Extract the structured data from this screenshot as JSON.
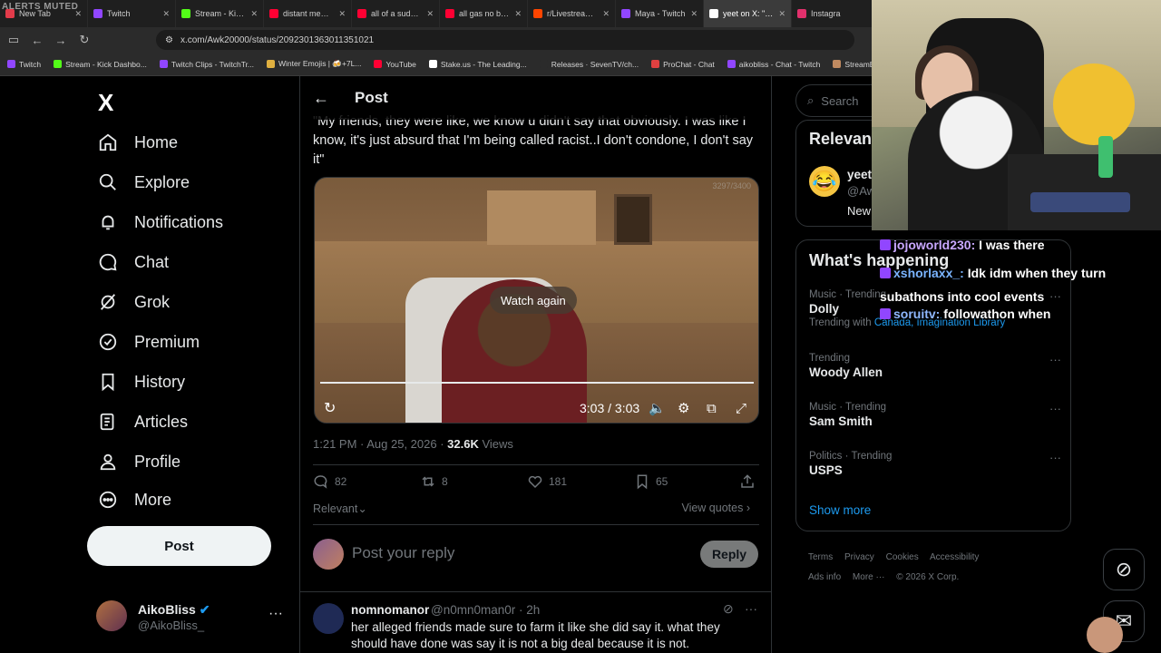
{
  "browser": {
    "overlay_label": "ALERTS MUTED",
    "tabs": [
      {
        "title": "New Tab",
        "color": "#e23b4a"
      },
      {
        "title": "Twitch",
        "color": "#9146ff"
      },
      {
        "title": "Stream - Kick Da",
        "color": "#53fc18"
      },
      {
        "title": "distant memorie",
        "color": "#ff0033"
      },
      {
        "title": "all of a sudden, e",
        "color": "#ff0033"
      },
      {
        "title": "all gas no brakes",
        "color": "#ff0033"
      },
      {
        "title": "r/LivestreamFail",
        "color": "#ff4500"
      },
      {
        "title": "Maya - Twitch",
        "color": "#9146ff"
      },
      {
        "title": "yeet on X: \"Bonn",
        "color": "#ffffff"
      },
      {
        "title": "Instagra",
        "color": "#e1306c"
      }
    ],
    "url": "x.com/Awk20000/status/2092301363011351021",
    "bookmarks": [
      {
        "label": "Twitch",
        "color": "#9146ff"
      },
      {
        "label": "Stream - Kick Dashbo...",
        "color": "#53fc18"
      },
      {
        "label": "Twitch Clips - TwitchTr...",
        "color": "#9146ff"
      },
      {
        "label": "Winter Emojis | 🍻+7L...",
        "color": "#e0b040"
      },
      {
        "label": "YouTube",
        "color": "#ff0033"
      },
      {
        "label": "Stake.us - The Leading...",
        "color": "#ffffff"
      },
      {
        "label": "Releases · SevenTV/ch...",
        "color": "#2b2b2b"
      },
      {
        "label": "ProChat - Chat",
        "color": "#e04040"
      },
      {
        "label": "aikobliss - Chat - Twitch",
        "color": "#9146ff"
      },
      {
        "label": "StreamElements - Das...",
        "color": "#c08a60"
      }
    ]
  },
  "nav": {
    "logo": "X",
    "items": [
      {
        "label": "Home",
        "icon": "home-icon"
      },
      {
        "label": "Explore",
        "icon": "search-icon"
      },
      {
        "label": "Notifications",
        "icon": "bell-icon"
      },
      {
        "label": "Chat",
        "icon": "chat-icon"
      },
      {
        "label": "Grok",
        "icon": "grok-icon"
      },
      {
        "label": "Premium",
        "icon": "premium-icon"
      },
      {
        "label": "History",
        "icon": "bookmark-icon"
      },
      {
        "label": "Articles",
        "icon": "articles-icon"
      },
      {
        "label": "Profile",
        "icon": "profile-icon"
      },
      {
        "label": "More",
        "icon": "more-circle-icon"
      }
    ],
    "post_button": "Post",
    "account": {
      "name": "AikoBliss",
      "handle": "@AikoBliss_"
    }
  },
  "post": {
    "header_title": "Post",
    "text": "\"My friends, they were like, we know u didn't say that obviously. I was like I know, it's just absurd that I'm being called racist..I don't condone, I don't say it\"",
    "video": {
      "counter": "3297/3400",
      "watch_again": "Watch again",
      "time": "3:03 / 3:03"
    },
    "meta_time": "1:21 PM · Aug 25, 2026 · ",
    "views_count": "32.6K",
    "views_label": " Views",
    "stats": {
      "replies": "82",
      "reposts": "8",
      "likes": "181",
      "bookmarks": "65"
    },
    "sort_label": "Relevant",
    "view_quotes": "View quotes",
    "reply_placeholder": "Post your reply",
    "reply_button": "Reply"
  },
  "comment": {
    "name": "nomnomanor",
    "handle": "@n0mn0man0r · 2h",
    "text": "her alleged friends made sure to farm it like she did say it. what they should have done was say it is not a big deal because it is not."
  },
  "sidebar": {
    "search_placeholder": "Search",
    "relevant_title": "Relevant",
    "relevant_user": {
      "name": "yeet",
      "handle": "@Aw",
      "bio": "New"
    },
    "happening_title": "What's happening",
    "trends": [
      {
        "category": "Music · Trending",
        "name": "Dolly",
        "sub_prefix": "Trending with ",
        "sub_links": "Canada, Imagination Library"
      },
      {
        "category": "Trending",
        "name": "Woody Allen"
      },
      {
        "category": "Music · Trending",
        "name": "Sam Smith"
      },
      {
        "category": "Politics · Trending",
        "name": "USPS"
      }
    ],
    "show_more": "Show more",
    "footer_links": [
      "Terms",
      "Privacy",
      "Cookies",
      "Accessibility",
      "Ads info",
      "More ···"
    ],
    "copyright": "© 2026 X Corp."
  },
  "stream_chat": [
    {
      "user": "jojoworld230:",
      "message": " I was there"
    },
    {
      "user": "xshorlaxx_:",
      "message": " Idk idm when they turn subathons into cool events"
    },
    {
      "user": "soruitv:",
      "message": " followathon when"
    }
  ],
  "colors": {
    "accent": "#1d9bf0",
    "background": "#000000",
    "border": "#2f3336",
    "muted": "#71767b"
  }
}
